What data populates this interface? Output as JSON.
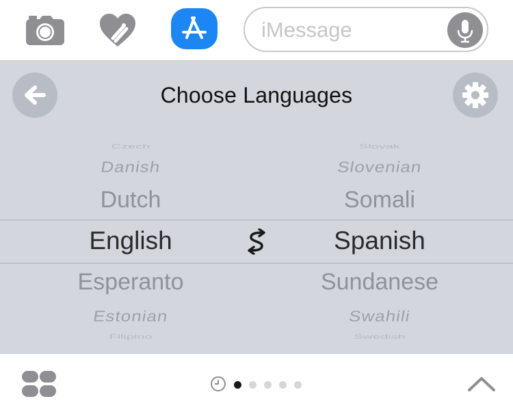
{
  "topbar": {
    "camera_icon": "camera-icon",
    "digital_touch_icon": "heart-icon",
    "appstore_icon": "app-store-icon",
    "accent": "#1c86f2",
    "message_placeholder": "iMessage",
    "mic_icon": "microphone-icon"
  },
  "panel": {
    "title": "Choose Languages",
    "back_icon": "back-arrow-icon",
    "settings_icon": "gear-icon",
    "swap_icon": "swap-icon",
    "background": "#d3d6dd"
  },
  "source_languages": {
    "items": [
      "Czech",
      "Danish",
      "Dutch",
      "English",
      "Esperanto",
      "Estonian",
      "Filipino"
    ],
    "selected": "English"
  },
  "target_languages": {
    "items": [
      "Slovak",
      "Slovenian",
      "Somali",
      "Spanish",
      "Sundanese",
      "Swahili",
      "Swedish"
    ],
    "selected": "Spanish"
  },
  "bottombar": {
    "apps_icon": "app-drawer-icon",
    "recents_icon": "clock-icon",
    "page_count": 5,
    "active_page": 1,
    "collapse_icon": "chevron-up-icon"
  }
}
